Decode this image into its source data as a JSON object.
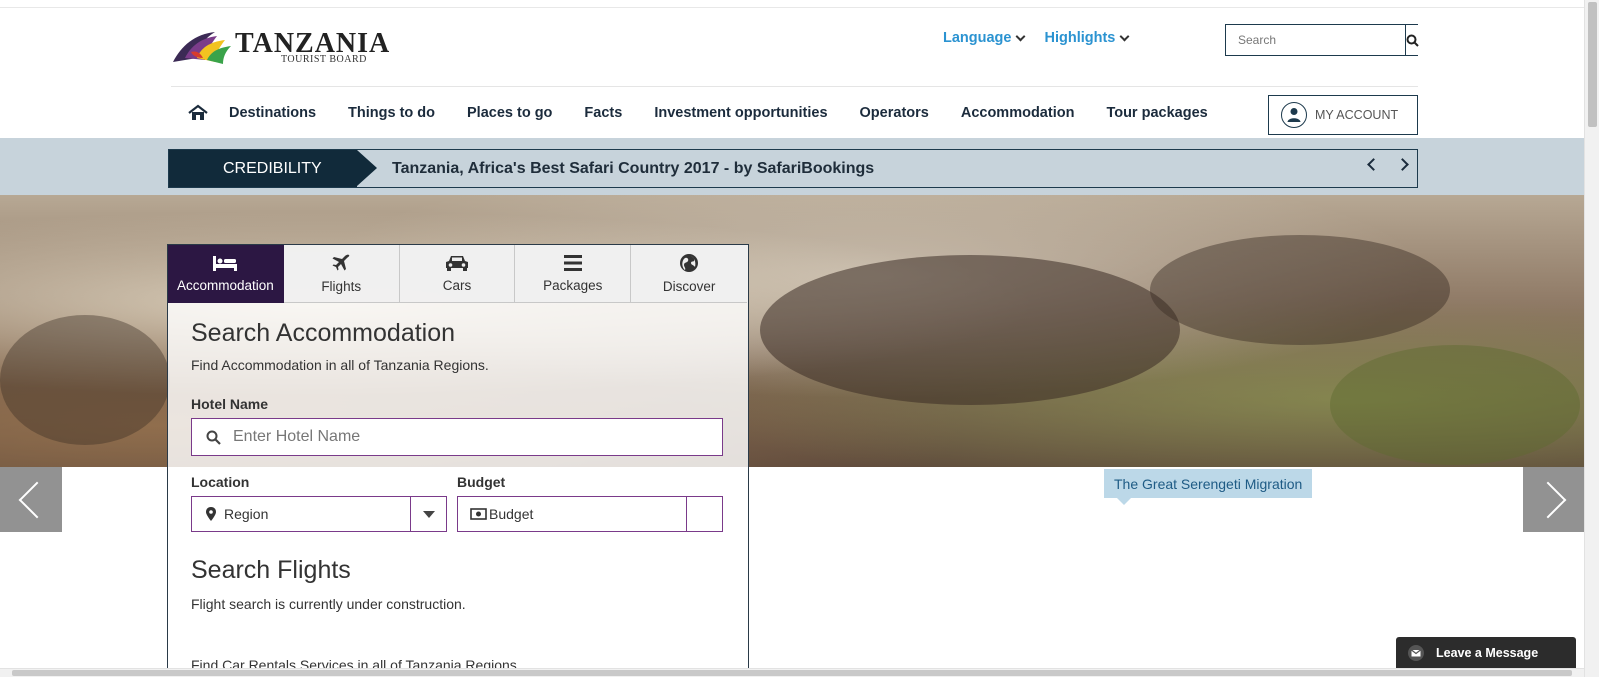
{
  "header": {
    "logo_title": "TANZANIA",
    "logo_subtitle": "TOURIST BOARD",
    "links": [
      {
        "label": "Language",
        "icon": "chevron-down-icon"
      },
      {
        "label": "Highlights",
        "icon": "chevron-down-icon"
      }
    ],
    "search_placeholder": "Search",
    "account_label": "MY ACCOUNT"
  },
  "nav": {
    "home_icon": "home-icon",
    "items": [
      "Destinations",
      "Things to do",
      "Places to go",
      "Facts",
      "Investment opportunities",
      "Operators",
      "Accommodation",
      "Tour packages"
    ]
  },
  "ticker": {
    "label": "CREDIBILITY",
    "text": "Tanzania, Africa's Best Safari Country 2017 - by SafariBookings"
  },
  "hero": {
    "caption": "The Great Serengeti Migration"
  },
  "search_panel": {
    "tabs": [
      {
        "label": "Accommodation",
        "icon": "bed-icon",
        "active": true
      },
      {
        "label": "Flights",
        "icon": "plane-icon",
        "active": false
      },
      {
        "label": "Cars",
        "icon": "car-icon",
        "active": false
      },
      {
        "label": "Packages",
        "icon": "list-icon",
        "active": false
      },
      {
        "label": "Discover",
        "icon": "globe-icon",
        "active": false
      }
    ],
    "title": "Search Accommodation",
    "subtitle": "Find Accommodation in all of Tanzania Regions.",
    "hotel_label": "Hotel Name",
    "hotel_placeholder": "Enter Hotel Name",
    "location_label": "Location",
    "location_value": "Region",
    "budget_label": "Budget",
    "budget_value": "Budget",
    "flights_title": "Search Flights",
    "flights_note": "Flight search is currently under construction.",
    "cars_note": "Find Car Rentals Services in all of Tanzania Regions."
  },
  "chat": {
    "label": "Leave a Message"
  },
  "colors": {
    "link_blue": "#2b93d1",
    "navy": "#112a3a",
    "tab_active": "#2c1743",
    "ticker_bg": "#c7d3db",
    "caption_bg": "#bcd8e8"
  }
}
